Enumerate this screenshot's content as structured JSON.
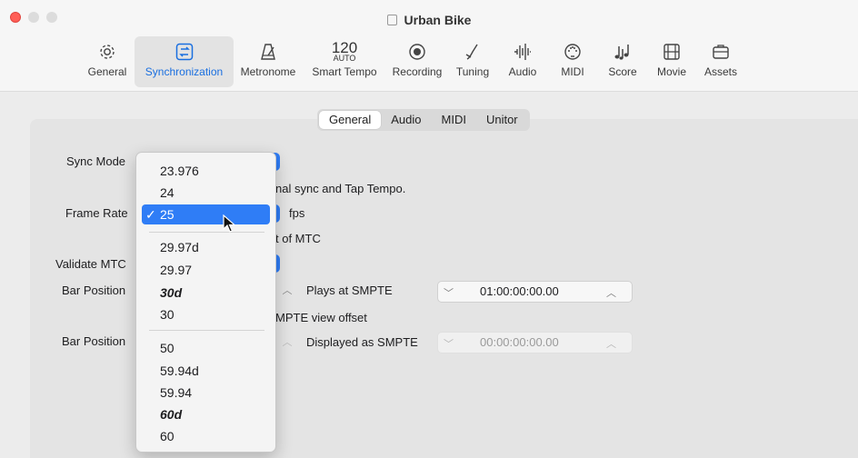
{
  "window": {
    "title": "Urban Bike",
    "controls": [
      "close",
      "minimize",
      "zoom"
    ]
  },
  "toolbar": {
    "items": [
      {
        "label": "General",
        "icon": "gear-icon"
      },
      {
        "label": "Synchronization",
        "icon": "sync-icon",
        "selected": true
      },
      {
        "label": "Metronome",
        "icon": "metronome-icon"
      },
      {
        "label": "Smart Tempo",
        "icon": "smart-tempo-icon",
        "value": "120",
        "sub": "AUTO"
      },
      {
        "label": "Recording",
        "icon": "record-icon"
      },
      {
        "label": "Tuning",
        "icon": "tuning-icon"
      },
      {
        "label": "Audio",
        "icon": "waveform-icon"
      },
      {
        "label": "MIDI",
        "icon": "midi-icon"
      },
      {
        "label": "Score",
        "icon": "notes-icon"
      },
      {
        "label": "Movie",
        "icon": "film-icon"
      },
      {
        "label": "Assets",
        "icon": "briefcase-icon"
      }
    ]
  },
  "tabs": {
    "items": [
      "General",
      "Audio",
      "MIDI",
      "Unitor"
    ],
    "selected": "General"
  },
  "form": {
    "sync_mode_label": "Sync Mode",
    "sync_mode_hint": "nal sync and Tap Tempo.",
    "frame_rate_label": "Frame Rate",
    "frame_rate_unit": "fps",
    "frame_rate_hint": "t of MTC",
    "validate_mtc_label": "Validate MTC",
    "bar_position_1_label": "Bar Position",
    "plays_at_label": "Plays at SMPTE",
    "plays_at_value": "01:00:00:00.00",
    "smpte_view_hint": "MPTE view offset",
    "bar_position_2_label": "Bar Position",
    "displayed_as_label": "Displayed as SMPTE",
    "displayed_as_value": "00:00:00:00.00"
  },
  "frame_rate_menu": {
    "options": [
      "23.976",
      "24",
      "25",
      "29.97d",
      "29.97",
      "30d",
      "30",
      "50",
      "59.94d",
      "59.94",
      "60d",
      "60"
    ],
    "selected": "25",
    "highlighted": "25",
    "checkmark": "✓",
    "bold_italic": [
      "30d",
      "60d"
    ]
  },
  "colors": {
    "accent": "#2f7df6",
    "close": "#ff5f57",
    "selected_label": "#1a6fe0"
  }
}
